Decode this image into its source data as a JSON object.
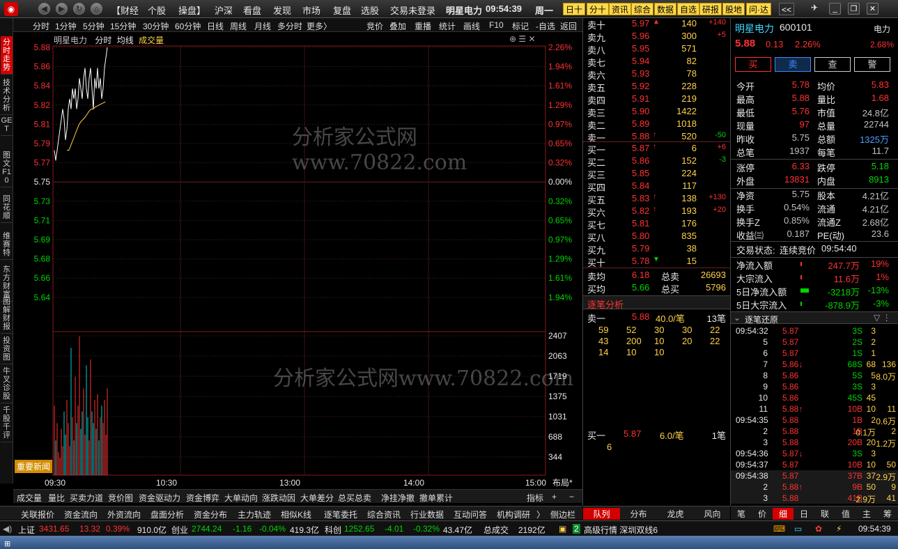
{
  "app": {
    "logo": "◉",
    "menus": [
      "【财经",
      "个股",
      "操盘】",
      "沪深",
      "看盘",
      "发现",
      "市场",
      "复盘",
      "选股"
    ],
    "trade_status": "交易未登录",
    "stock_title": "明星电力",
    "clock": "09:54:39",
    "weekday": "周一",
    "right_buttons": [
      "日十",
      "分十",
      "资讯",
      "综合",
      "数据",
      "自选",
      "研报",
      "股地",
      "问·达",
      "<<"
    ]
  },
  "left_tabs": [
    "分时走势",
    "技术分析",
    "GET",
    "图文F10",
    "同花顺",
    "维赛特",
    "东方财富",
    "图解财报",
    "投资图",
    "牛叉诊股",
    "千股千评"
  ],
  "timeframes": [
    "分时",
    "1分钟",
    "5分钟",
    "15分钟",
    "30分钟",
    "60分钟",
    "日线",
    "周线",
    "月线",
    "多分时",
    "更多〉"
  ],
  "tools": [
    "竞价",
    "叠加",
    "重播",
    "统计",
    "画线",
    "F10",
    "标记",
    "-自选",
    "返回"
  ],
  "chart_header": {
    "name": "明星电力",
    "mode": "分时",
    "avg": "均线",
    "vol": "成交量"
  },
  "watermark": "分析家公式网www.70822.com",
  "news_label": "重要新闻",
  "chart_data": {
    "type": "line",
    "title": "明星电力 分时",
    "x_labels": [
      "09:30",
      "10:30",
      "13:00",
      "14:00",
      "15:00"
    ],
    "layout_label": "布局*",
    "price_ticks": [
      {
        "v": "5.88",
        "c": "red",
        "p": "2.26%"
      },
      {
        "v": "5.86",
        "c": "red",
        "p": "1.94%"
      },
      {
        "v": "5.84",
        "c": "red",
        "p": "1.61%"
      },
      {
        "v": "5.82",
        "c": "red",
        "p": "1.29%"
      },
      {
        "v": "5.81",
        "c": "red",
        "p": "0.97%"
      },
      {
        "v": "5.79",
        "c": "red",
        "p": "0.65%"
      },
      {
        "v": "5.77",
        "c": "red",
        "p": "0.32%"
      },
      {
        "v": "5.75",
        "c": "wht",
        "p": "0.00%"
      },
      {
        "v": "5.73",
        "c": "grn",
        "p": "0.32%"
      },
      {
        "v": "5.71",
        "c": "grn",
        "p": "0.65%"
      },
      {
        "v": "5.69",
        "c": "grn",
        "p": "0.97%"
      },
      {
        "v": "5.68",
        "c": "grn",
        "p": "1.29%"
      },
      {
        "v": "5.66",
        "c": "grn",
        "p": "1.61%"
      },
      {
        "v": "5.64",
        "c": "grn",
        "p": "1.94%"
      }
    ],
    "vol_ticks": [
      "2407",
      "2063",
      "1719",
      "1375",
      "1031",
      "688",
      "344"
    ],
    "ylim": [
      5.62,
      5.88
    ],
    "price_series": [
      5.78,
      5.77,
      5.78,
      5.79,
      5.8,
      5.81,
      5.82,
      5.81,
      5.79,
      5.8,
      5.82,
      5.83,
      5.82,
      5.84,
      5.83,
      5.84,
      5.82,
      5.83,
      5.85,
      5.84,
      5.83,
      5.85,
      5.86,
      5.84,
      5.83,
      5.85,
      5.86,
      5.84,
      5.82,
      5.85,
      5.84,
      5.86,
      5.84,
      5.85,
      5.83,
      5.84,
      5.86,
      5.87,
      5.88
    ],
    "avg_series": [
      5.78,
      5.78,
      5.785,
      5.79,
      5.795,
      5.8,
      5.805,
      5.808,
      5.81,
      5.812,
      5.815,
      5.818,
      5.82,
      5.82,
      5.822,
      5.823,
      5.824,
      5.825,
      5.826,
      5.827
    ],
    "volume": [
      1200,
      600,
      900,
      400,
      300,
      800,
      500,
      1100,
      700,
      1300,
      900,
      500,
      2200,
      1000,
      600,
      1700,
      900,
      1200,
      2400,
      800,
      1100,
      1500,
      700,
      1900,
      1000,
      600,
      2000,
      1100,
      900,
      1300,
      800,
      1400,
      600,
      1000,
      1200,
      900,
      1300,
      700,
      1500
    ],
    "vol_max": 2407
  },
  "bottom_tabs": [
    "成交量",
    "量比",
    "买卖力道",
    "竞价图",
    "资金驱动力",
    "资金博弈",
    "大单动向",
    "涨跌动因",
    "大单差分",
    "总买总卖",
    "净挂净撤",
    "撤单累计"
  ],
  "bottom_right": [
    "指标",
    "+",
    "−"
  ],
  "func_tabs": [
    "关联报价",
    "资金流向",
    "外资流向",
    "盘面分析",
    "资金分布",
    "主力轨迹",
    "相似K线",
    "逐笔委托",
    "综合资讯",
    "行业数据",
    "互动问答",
    "机构调研",
    "〉",
    "侧边栏"
  ],
  "book": {
    "asks": [
      {
        "l": "卖十",
        "p": "5.97",
        "a": "▲",
        "v": "140",
        "d": "+140"
      },
      {
        "l": "卖九",
        "p": "5.96",
        "a": "",
        "v": "300",
        "d": "+5"
      },
      {
        "l": "卖八",
        "p": "5.95",
        "a": "",
        "v": "571",
        "d": ""
      },
      {
        "l": "卖七",
        "p": "5.94",
        "a": "",
        "v": "82",
        "d": ""
      },
      {
        "l": "卖六",
        "p": "5.93",
        "a": "",
        "v": "78",
        "d": ""
      },
      {
        "l": "卖五",
        "p": "5.92",
        "a": "",
        "v": "228",
        "d": ""
      },
      {
        "l": "卖四",
        "p": "5.91",
        "a": "",
        "v": "219",
        "d": ""
      },
      {
        "l": "卖三",
        "p": "5.90",
        "a": "",
        "v": "1422",
        "d": ""
      },
      {
        "l": "卖二",
        "p": "5.89",
        "a": "",
        "v": "1018",
        "d": ""
      },
      {
        "l": "卖一",
        "p": "5.88",
        "a": "↑",
        "v": "520",
        "d": "-50"
      }
    ],
    "bids": [
      {
        "l": "买一",
        "p": "5.87",
        "a": "↑",
        "v": "6",
        "d": "+6"
      },
      {
        "l": "买二",
        "p": "5.86",
        "a": "",
        "v": "152",
        "d": "-3"
      },
      {
        "l": "买三",
        "p": "5.85",
        "a": "",
        "v": "224",
        "d": ""
      },
      {
        "l": "买四",
        "p": "5.84",
        "a": "",
        "v": "117",
        "d": ""
      },
      {
        "l": "买五",
        "p": "5.83",
        "a": "↑",
        "v": "138",
        "d": "+130"
      },
      {
        "l": "买六",
        "p": "5.82",
        "a": "↑",
        "v": "193",
        "d": "+20"
      },
      {
        "l": "买七",
        "p": "5.81",
        "a": "",
        "v": "176",
        "d": ""
      },
      {
        "l": "买八",
        "p": "5.80",
        "a": "",
        "v": "835",
        "d": ""
      },
      {
        "l": "买九",
        "p": "5.79",
        "a": "",
        "v": "38",
        "d": ""
      },
      {
        "l": "买十",
        "p": "5.78",
        "a": "▼",
        "v": "15",
        "d": ""
      }
    ],
    "avg_sell_l": "卖均",
    "avg_sell": "6.18",
    "tot_sell_l": "总卖",
    "tot_sell": "26693",
    "avg_buy_l": "买均",
    "avg_buy": "5.66",
    "tot_buy_l": "总买",
    "tot_buy": "5796",
    "tick_title": "逐笔分析",
    "ask1": {
      "l": "卖一",
      "p": "5.88",
      "q": "40.0/笔",
      "n": "13笔"
    },
    "ask1_list": [
      [
        "59",
        "52",
        "30",
        "30",
        "22"
      ],
      [
        "43",
        "200",
        "10",
        "20",
        "22"
      ],
      [
        "14",
        "10",
        "10",
        "",
        ""
      ]
    ],
    "bid1": {
      "l": "买一",
      "p": "5.87",
      "q": "6.0/笔",
      "n": "1笔"
    },
    "bid1_list": [
      "6"
    ],
    "tabs": [
      "队列",
      "分布",
      "龙虎",
      "风向"
    ]
  },
  "info": {
    "name": "明星电力",
    "code": "600101",
    "sector": "电力",
    "price": "5.88",
    "chg": "0.13",
    "pct": "2.26%",
    "sector_pct": "2.68%",
    "buttons": [
      "买",
      "卖",
      "查",
      "警"
    ],
    "rows": [
      [
        "今开",
        "5.78",
        "red",
        "均价",
        "5.83",
        "red"
      ],
      [
        "最高",
        "5.88",
        "red",
        "量比",
        "1.68",
        "red"
      ],
      [
        "最低",
        "5.76",
        "red",
        "市值",
        "24.8亿",
        "gry"
      ],
      [
        "现量",
        "97",
        "red",
        "总量",
        "22744",
        "gry"
      ],
      [
        "昨收",
        "5.75",
        "gry",
        "总额",
        "1325万",
        "blu"
      ],
      [
        "总笔",
        "1937",
        "gry",
        "每笔",
        "11.7",
        "gry"
      ]
    ],
    "rows2": [
      [
        "涨停",
        "6.33",
        "red",
        "跌停",
        "5.18",
        "grn"
      ],
      [
        "外盘",
        "13831",
        "red",
        "内盘",
        "8913",
        "grn"
      ]
    ],
    "rows3": [
      [
        "净资",
        "5.75",
        "gry",
        "股本",
        "4.21亿",
        "gry"
      ],
      [
        "换手",
        "0.54%",
        "gry",
        "流通",
        "4.21亿",
        "gry"
      ],
      [
        "换手Z",
        "0.85%",
        "gry",
        "流通Z",
        "2.68亿",
        "gry"
      ],
      [
        "收益㈢",
        "0.187",
        "gry",
        "PE(动)",
        "23.6",
        "gry"
      ]
    ],
    "trade_state_label": "交易状态:",
    "trade_state": "连续竞价",
    "trade_time": "09:54:40",
    "flows": [
      [
        "净流入额",
        "247.7万",
        "19%",
        "red"
      ],
      [
        "大宗流入",
        "11.6万",
        "1%",
        "red"
      ],
      [
        "5日净流入额",
        "-3218万",
        "-13%",
        "grn"
      ],
      [
        "5日大宗流入",
        "-878.9万",
        "-3%",
        "grn"
      ]
    ],
    "ticks_title": "逐笔还原",
    "ticks": [
      [
        "09:54:32",
        "5.87",
        "3S",
        "3",
        ""
      ],
      [
        "5",
        "5.87",
        "2S",
        "2",
        ""
      ],
      [
        "6",
        "5.87",
        "1S",
        "1",
        ""
      ],
      [
        "7",
        "5.86↓",
        "68S",
        "68",
        "136"
      ],
      [
        "8",
        "5.86",
        "5S",
        "5",
        "8.0万"
      ],
      [
        "9",
        "5.86",
        "3S",
        "3",
        ""
      ],
      [
        "10",
        "5.86",
        "45S",
        "45",
        ""
      ],
      [
        "11",
        "5.88↑",
        "10B",
        "10",
        "11"
      ],
      [
        "09:54:35",
        "5.88",
        "1B",
        "2",
        "0.6万"
      ],
      [
        "2",
        "5.88",
        "1B",
        "0.1万",
        "2"
      ],
      [
        "3",
        "5.88",
        "20B",
        "20",
        "1.2万"
      ],
      [
        "09:54:36",
        "5.87↓",
        "3S",
        "3",
        ""
      ],
      [
        "09:54:37",
        "5.87",
        "10B",
        "10",
        "50"
      ],
      [
        "09:54:38",
        "5.87",
        "37B",
        "37",
        "2.9万"
      ],
      [
        "2",
        "5.88↑",
        "9B",
        "50",
        "9"
      ],
      [
        "3",
        "5.88",
        "41B",
        "2.9万",
        "41"
      ]
    ],
    "side_tabs": [
      "笔",
      "价",
      "细",
      "日",
      "联",
      "值",
      "主",
      "筹"
    ]
  },
  "status": {
    "sh_l": "上证",
    "sh": "3431.65",
    "sh_c": "13.32",
    "sh_p": "0.39%",
    "sh_a": "910.0亿",
    "cy_l": "创业",
    "cy": "2744.24",
    "cy_c": "-1.16",
    "cy_p": "-0.04%",
    "cy_a": "419.3亿",
    "kc_l": "科创",
    "kc": "1252.65",
    "kc_c": "-4.01",
    "kc_p": "-0.32%",
    "kc_a": "43.47亿",
    "tot_l": "总成交",
    "tot": "2192亿",
    "feed": "高级行情 深圳双线6",
    "time": "09:54:39"
  }
}
